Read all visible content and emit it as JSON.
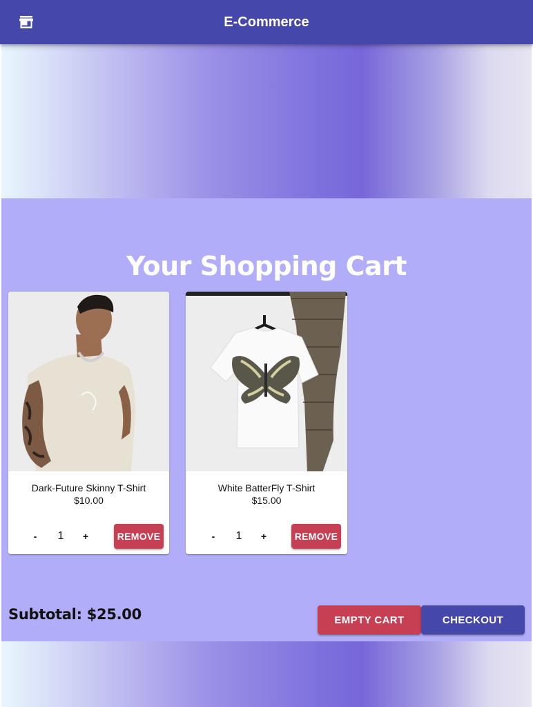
{
  "appbar": {
    "title": "E-Commerce",
    "store_icon": "storefront-icon"
  },
  "cart": {
    "heading": "Your Shopping Cart",
    "items": [
      {
        "name": "Dark-Future Skinny T-Shirt",
        "price": "$10.00",
        "quantity": "1",
        "decrement_label": "-",
        "increment_label": "+",
        "remove_label": "REMOVE",
        "image": "man-wearing-beige-t-shirt"
      },
      {
        "name": "White BatterFly T-Shirt",
        "price": "$15.00",
        "quantity": "1",
        "decrement_label": "-",
        "increment_label": "+",
        "remove_label": "REMOVE",
        "image": "white-butterfly-t-shirt-on-hanger"
      }
    ],
    "subtotal": "Subtotal: $25.00",
    "empty_label": "EMPTY CART",
    "checkout_label": "CHECKOUT"
  },
  "colors": {
    "primary": "#4547a9",
    "danger": "#c63f52",
    "cart_background": "#b1adf8"
  }
}
